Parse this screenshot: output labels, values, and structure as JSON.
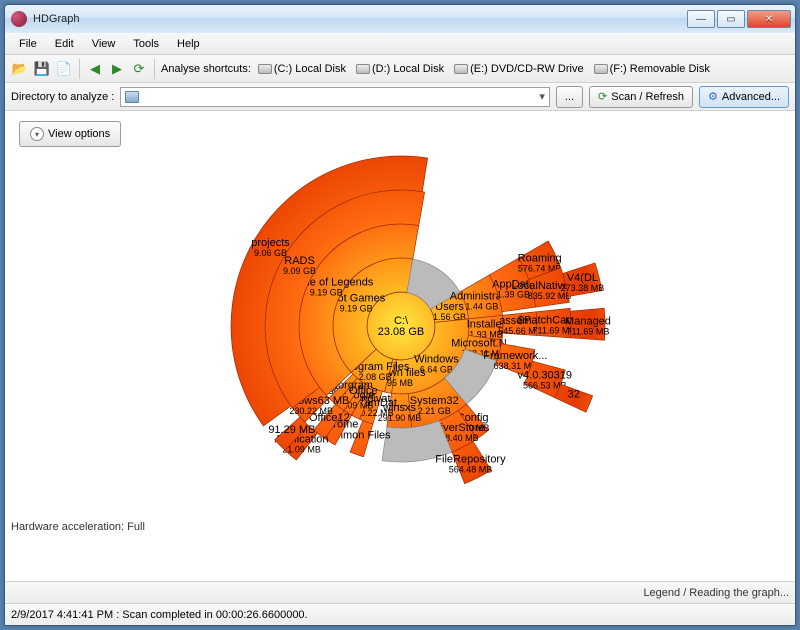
{
  "window": {
    "title": "HDGraph"
  },
  "menu": {
    "items": [
      "File",
      "Edit",
      "View",
      "Tools",
      "Help"
    ]
  },
  "toolbar": {
    "analyse_label": "Analyse shortcuts:",
    "shortcuts": [
      {
        "label": "(C:) Local Disk"
      },
      {
        "label": "(D:) Local Disk"
      },
      {
        "label": "(E:) DVD/CD-RW Drive"
      },
      {
        "label": "(F:) Removable Disk"
      }
    ]
  },
  "pathbar": {
    "label": "Directory to analyze :",
    "value": "",
    "browse": "...",
    "scan": "Scan / Refresh",
    "advanced": "Advanced..."
  },
  "view_options": {
    "label": "View options"
  },
  "footer": {
    "hwaccel": "Hardware acceleration: Full",
    "legend": "Legend / Reading the graph..."
  },
  "status": {
    "text": "2/9/2017 4:41:41 PM : Scan completed in 00:00:26.6600000."
  },
  "chart_data": {
    "type": "sunburst",
    "title": "",
    "unit": "bytes (mixed MB/GB as labeled)",
    "root": {
      "name": "C:\\",
      "size_label": "23.08 GB"
    },
    "rings": [
      [
        {
          "name": "Users",
          "size_label": "1.56 GB",
          "start": 60,
          "span": 24
        },
        {
          "name": "Windows",
          "size_label": "6.64 GB",
          "start": 84,
          "span": 104
        },
        {
          "name": "Unknown files",
          "size_label": "347.95 MB",
          "start": 188,
          "span": 6
        },
        {
          "name": "Program Files",
          "size_label": "2.08 GB",
          "start": 194,
          "span": 33
        },
        {
          "name": "Riot Games",
          "size_label": "9.19 GB",
          "start": 227,
          "span": 143
        },
        {
          "name": "",
          "size_label": "",
          "start": 10,
          "span": 50,
          "gray": true
        }
      ],
      [
        {
          "name": "Administrat...",
          "size_label": "1.44 GB",
          "start": 60,
          "span": 24
        },
        {
          "name": "Installer",
          "size_label": "1.93 MB",
          "start": 84,
          "span": 14
        },
        {
          "name": "Microsoft.N...",
          "size_label": "768.11 MB",
          "start": 98,
          "span": 12
        },
        {
          "name": "System32",
          "size_label": "2.21 GB",
          "start": 140,
          "span": 34
        },
        {
          "name": "winsxs",
          "size_label": "291.90 MB",
          "start": 174,
          "span": 14
        },
        {
          "name": "ProgramDat...",
          "size_label": "230.22 MB",
          "start": 196,
          "span": 8
        },
        {
          "name": "Recondivat",
          "size_label": "",
          "start": 204,
          "span": 5
        },
        {
          "name": "Google",
          "size_label": "1.09 MB",
          "start": 209,
          "span": 5
        },
        {
          "name": "psoft Office",
          "size_label": "",
          "start": 214,
          "span": 6
        },
        {
          "name": "CElporgram",
          "size_label": "",
          "start": 220,
          "span": 5
        },
        {
          "name": "League of Legends",
          "size_label": "9.19 GB",
          "start": 227,
          "span": 143
        },
        {
          "name": "",
          "size_label": "",
          "start": 110,
          "span": 30,
          "gray": true
        }
      ],
      [
        {
          "name": "AppData",
          "size_label": "1.39 GB",
          "start": 60,
          "span": 22
        },
        {
          "name": "assem...",
          "size_label": "545.66 MB",
          "start": 84,
          "span": 10
        },
        {
          "name": "Framework...",
          "size_label": "638.31 MB",
          "start": 100,
          "span": 12
        },
        {
          "name": "Config",
          "size_label": "27.0 MB",
          "start": 140,
          "span": 6
        },
        {
          "name": "DriverStore",
          "size_label": "768.40 MB",
          "start": 146,
          "span": 12
        },
        {
          "name": "",
          "size_label": "",
          "start": 158,
          "span": 30,
          "gray": true
        },
        {
          "name": "mmon Files",
          "size_label": "",
          "start": 196,
          "span": 6
        },
        {
          "name": "Chrome",
          "size_label": "",
          "start": 209,
          "span": 5
        },
        {
          "name": "Office12",
          "size_label": "",
          "start": 214,
          "span": 6
        },
        {
          "name": "Windows63 MB",
          "size_label": "230.22 MB",
          "start": 225,
          "span": 8
        },
        {
          "name": "RADS",
          "size_label": "9.09 GB",
          "start": 233,
          "span": 137
        }
      ],
      [
        {
          "name": "Roaming",
          "size_label": "576.74 MB",
          "start": 60,
          "span": 10
        },
        {
          "name": "LocalNativeIn...",
          "size_label": "835.92 MB",
          "start": 70,
          "span": 12
        },
        {
          "name": "$PatchCache$",
          "size_label": "711.69 MB",
          "start": 84,
          "span": 10
        },
        {
          "name": "v4.0.30319",
          "size_label": "566.53 MB",
          "start": 105,
          "span": 10
        },
        {
          "name": "FileRepository",
          "size_label": "564.48 MB",
          "start": 148,
          "span": 10
        },
        {
          "name": "Application",
          "size_label": "21.09 MB",
          "start": 218,
          "span": 5
        },
        {
          "name": "91.29 MB",
          "size_label": "",
          "start": 223,
          "span": 5
        },
        {
          "name": "projects",
          "size_label": "9.06 GB",
          "start": 234,
          "span": 135
        }
      ],
      [
        {
          "name": "V4(DL",
          "size_label": "273.38 MB",
          "start": 72,
          "span": 8
        },
        {
          "name": "Managed",
          "size_label": "711.69 MB",
          "start": 85,
          "span": 9
        },
        {
          "name": "32",
          "size_label": "",
          "start": 110,
          "span": 5
        }
      ]
    ]
  }
}
